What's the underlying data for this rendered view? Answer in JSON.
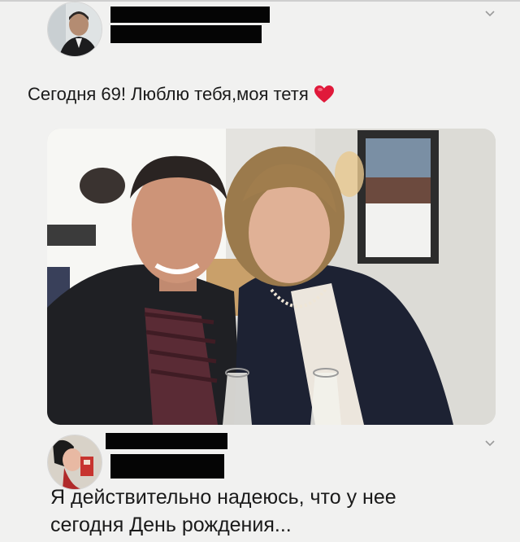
{
  "tweet": {
    "text": "Сегодня 69! Люблю тебя,моя тетя"
  },
  "reply": {
    "text_line1": "Я действительно надеюсь, что у нее",
    "text_line2": "сегодня День рождения..."
  },
  "icons": {
    "heart": "red-heart-emoji",
    "chevron": "chevron-down-icon"
  },
  "colors": {
    "background": "#f1f1f0",
    "redaction": "#050505",
    "heart": "#e0193a",
    "chevron": "#9b9b9b"
  }
}
